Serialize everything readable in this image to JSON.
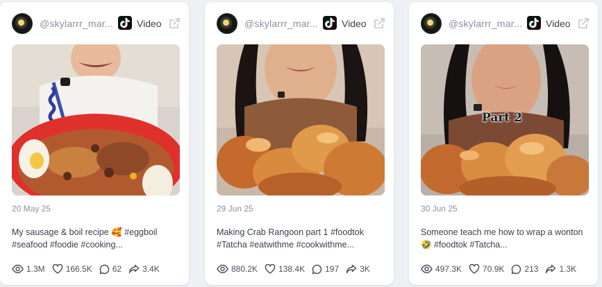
{
  "cards": [
    {
      "handle": "@skylarrr_mar...",
      "platform_icon": "tiktok-icon",
      "type_label": "Video",
      "date": "20 May 25",
      "caption": "My sausage & boil recipe 🥰 #eggboil #seafood #foodie #cooking...",
      "stats": {
        "views": "1.3M",
        "likes": "166.5K",
        "comments": "62",
        "shares": "3.4K"
      },
      "overlay": ""
    },
    {
      "handle": "@skylarrr_mar...",
      "platform_icon": "tiktok-icon",
      "type_label": "Video",
      "date": "29 Jun 25",
      "caption": "Making Crab Rangoon part 1 #foodtok #Tatcha #eatwithme #cookwithme...",
      "stats": {
        "views": "880.2K",
        "likes": "138.4K",
        "comments": "197",
        "shares": "3K"
      },
      "overlay": ""
    },
    {
      "handle": "@skylarrr_mar...",
      "platform_icon": "tiktok-icon",
      "type_label": "Video",
      "date": "30 Jun 25",
      "caption": "Someone teach me how to wrap a wonton 🤣 #foodtok #Tatcha...",
      "stats": {
        "views": "497.3K",
        "likes": "70.9K",
        "comments": "213",
        "shares": "1.3K"
      },
      "overlay": "Part 2"
    }
  ],
  "stat_icons": [
    "eye-icon",
    "heart-icon",
    "comment-icon",
    "share-icon"
  ],
  "colors": {
    "muted_text": "#8a90a0",
    "body_text": "#3a3f4d",
    "card_bg": "#ffffff",
    "page_bg": "#eef0f4"
  }
}
